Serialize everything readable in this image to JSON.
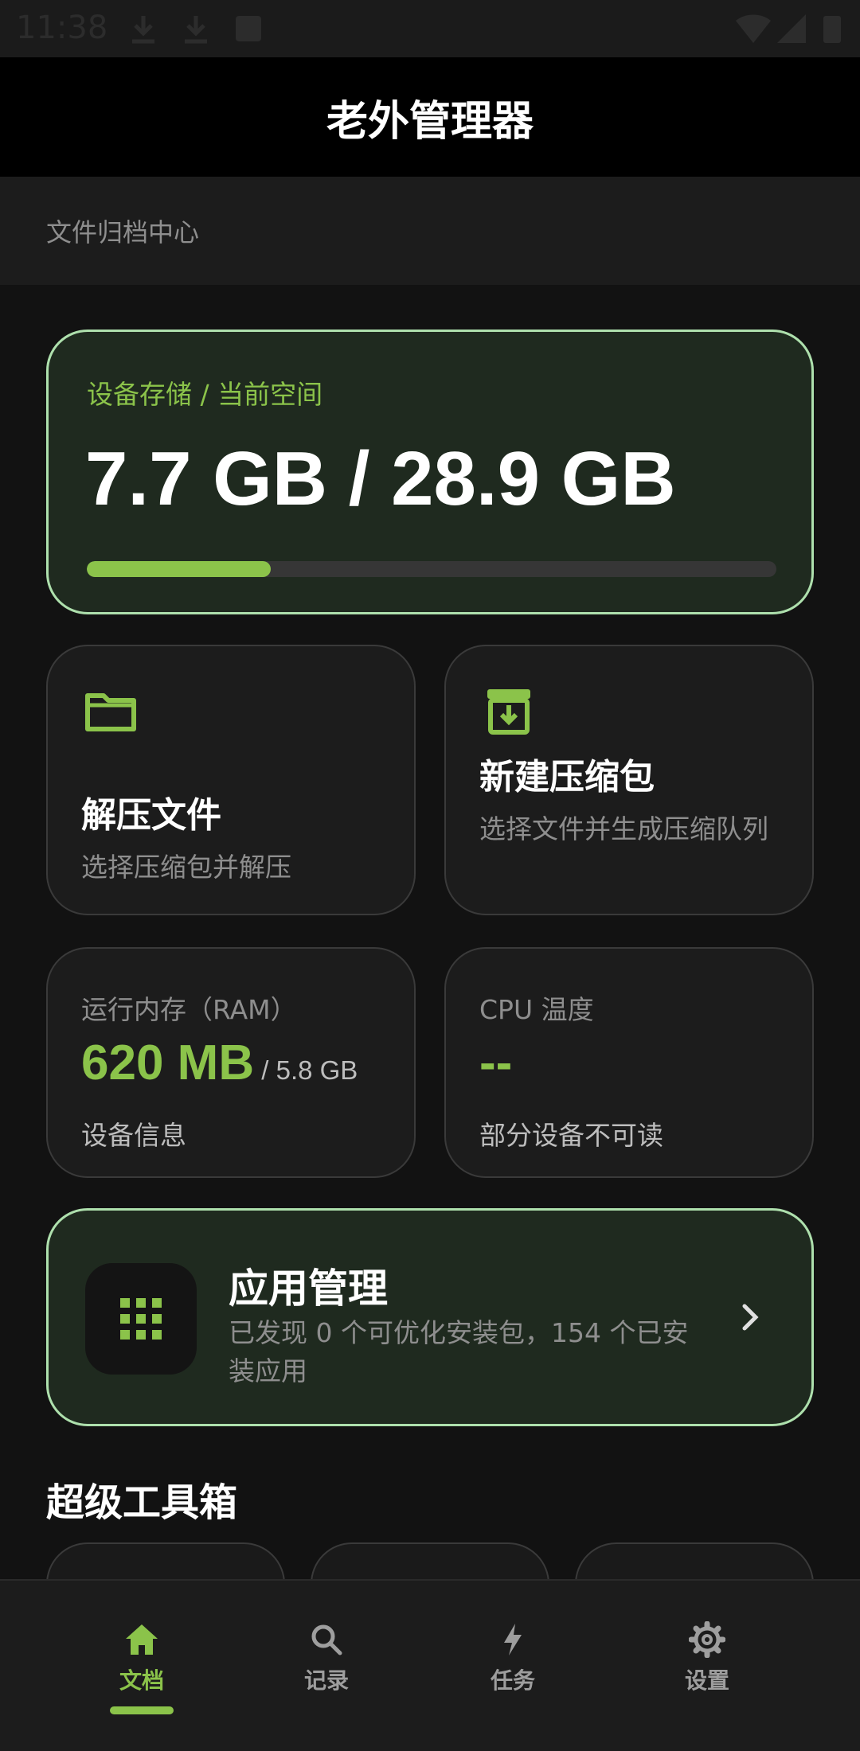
{
  "status_bar": {
    "time": "11:38"
  },
  "app_bar": {
    "title": "老外管理器"
  },
  "subheader": {
    "text": "文件归档中心"
  },
  "storage": {
    "label": "设备存储 / 当前空间",
    "value": "7.7 GB / 28.9 GB",
    "used_fraction": 0.267
  },
  "actions": {
    "extract": {
      "title": "解压文件",
      "desc": "选择压缩包并解压",
      "icon": "folder-icon"
    },
    "compress": {
      "title": "新建压缩包",
      "desc": "选择文件并生成压缩队列",
      "icon": "archive-download-icon"
    }
  },
  "stats": {
    "ram": {
      "label": "运行内存（RAM）",
      "value": "620 MB",
      "total": " / 5.8 GB",
      "footer": "设备信息"
    },
    "cpu": {
      "label": "CPU 温度",
      "value": "--",
      "footer": "部分设备不可读"
    }
  },
  "app_manage": {
    "title": "应用管理",
    "desc": "已发现 0 个可优化安装包，154 个已安装应用",
    "icon": "apps-grid-icon"
  },
  "toolbox": {
    "title": "超级工具箱"
  },
  "bottom_nav": [
    {
      "label": "文档",
      "icon": "home-icon",
      "active": true
    },
    {
      "label": "记录",
      "icon": "search-icon",
      "active": false
    },
    {
      "label": "任务",
      "icon": "bolt-icon",
      "active": false
    },
    {
      "label": "设置",
      "icon": "gear-icon",
      "active": false
    }
  ],
  "colors": {
    "accent": "#8bc34a",
    "card_border": "#aee0ad",
    "background": "#121212"
  }
}
